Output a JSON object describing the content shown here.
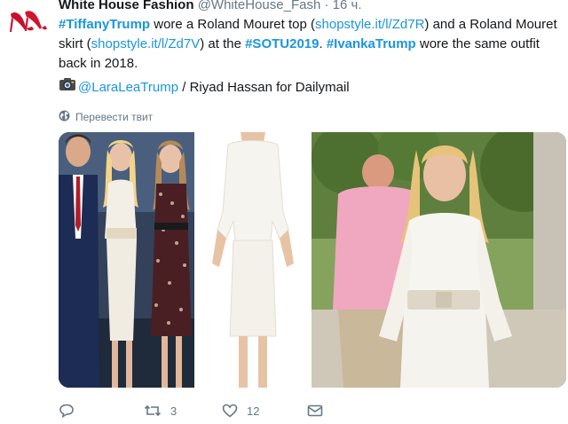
{
  "tweet": {
    "author_name": "White House Fashion",
    "author_handle": "@WhiteHouse_Fash",
    "separator": "·",
    "time": "16 ч.",
    "text": {
      "hashtag_tiffany": "#TiffanyTrump",
      "t1": " wore a Roland Mouret top (",
      "link1": "shopstyle.it/l/Zd7R",
      "t2": ") and a Roland Mouret skirt (",
      "link2": "shopstyle.it/l/Zd7V",
      "t3": ") at the ",
      "hashtag_sotu": "#SOTU2019",
      "t4": ". ",
      "hashtag_ivanka": "#IvankaTrump",
      "t5": " wore the same outfit back in 2018."
    },
    "credit": {
      "mention": "@LaraLeaTrump",
      "rest": " / Riyad Hassan for Dailymail"
    },
    "translate_label": "Перевести твит"
  },
  "actions": {
    "reply_count": "",
    "retweet_count": "3",
    "like_count": "12"
  },
  "colors": {
    "link": "#1b95e0",
    "muted": "#657786",
    "text": "#14171a",
    "avatar_heels": "#c8102e"
  },
  "icons": {
    "avatar": "red-heels-logo",
    "camera": "camera-icon",
    "globe": "globe-icon",
    "reply": "reply-icon",
    "retweet": "retweet-icon",
    "like": "heart-icon",
    "dm": "envelope-icon"
  }
}
